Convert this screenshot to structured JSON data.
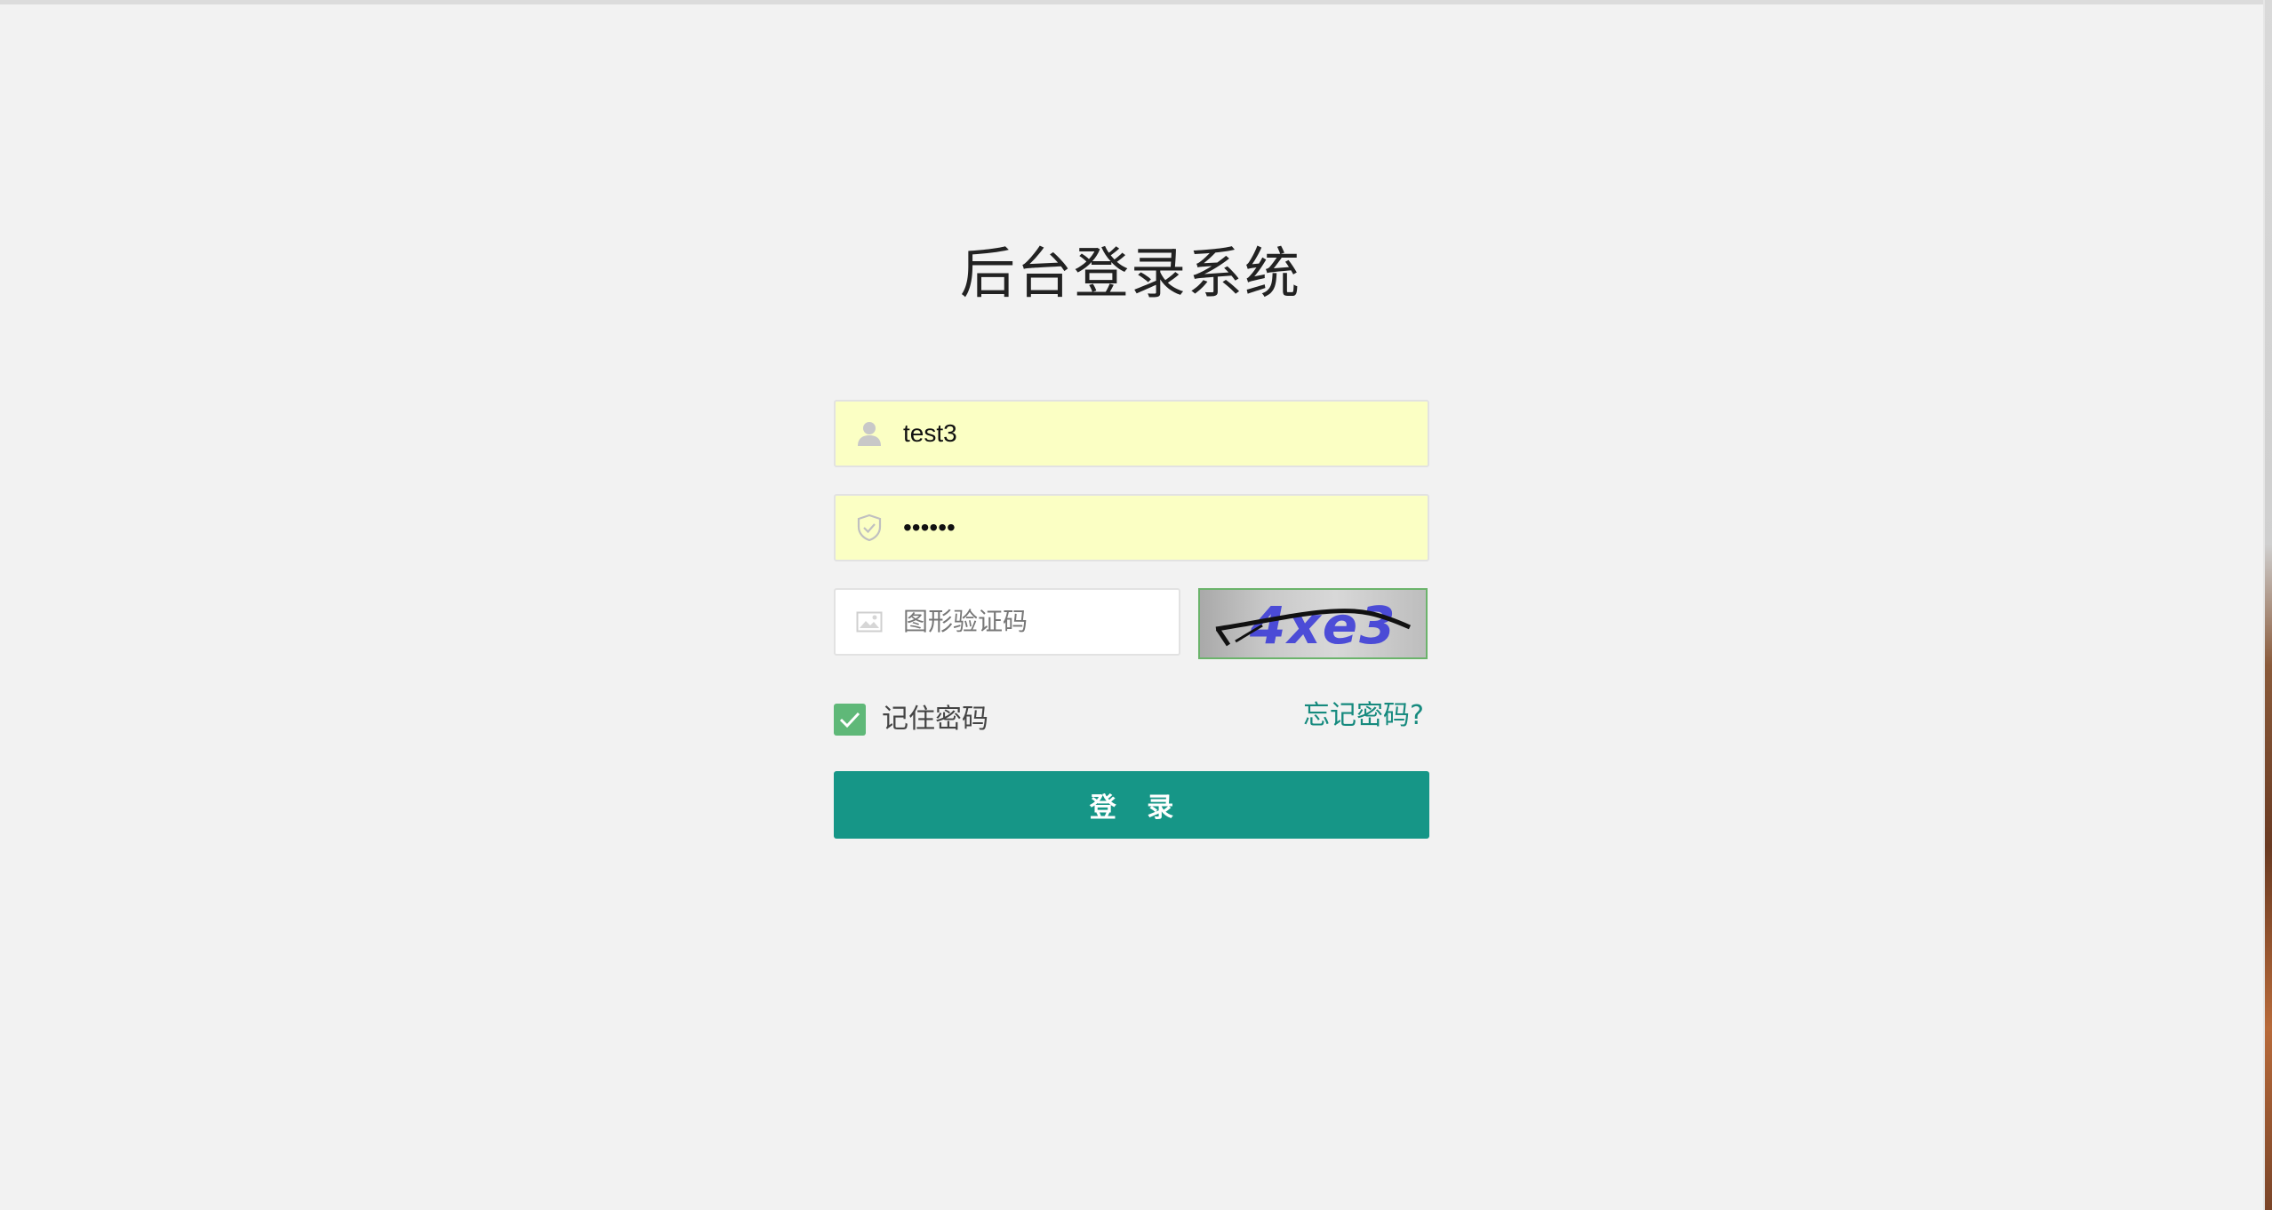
{
  "page": {
    "title": "后台登录系统"
  },
  "form": {
    "username": {
      "value": "test3",
      "icon": "user-icon"
    },
    "password": {
      "value": "••••••",
      "icon": "shield-icon"
    },
    "captcha": {
      "placeholder": "图形验证码",
      "icon": "image-icon",
      "image_text": "4xe3"
    },
    "remember": {
      "label": "记住密码",
      "checked": true
    },
    "forgot_label": "忘记密码?",
    "login_label": "登 录"
  },
  "colors": {
    "background": "#f2f2f2",
    "autofill": "#fbffc4",
    "primary": "#169687",
    "checkbox": "#5fb878",
    "link": "#168a7e"
  }
}
